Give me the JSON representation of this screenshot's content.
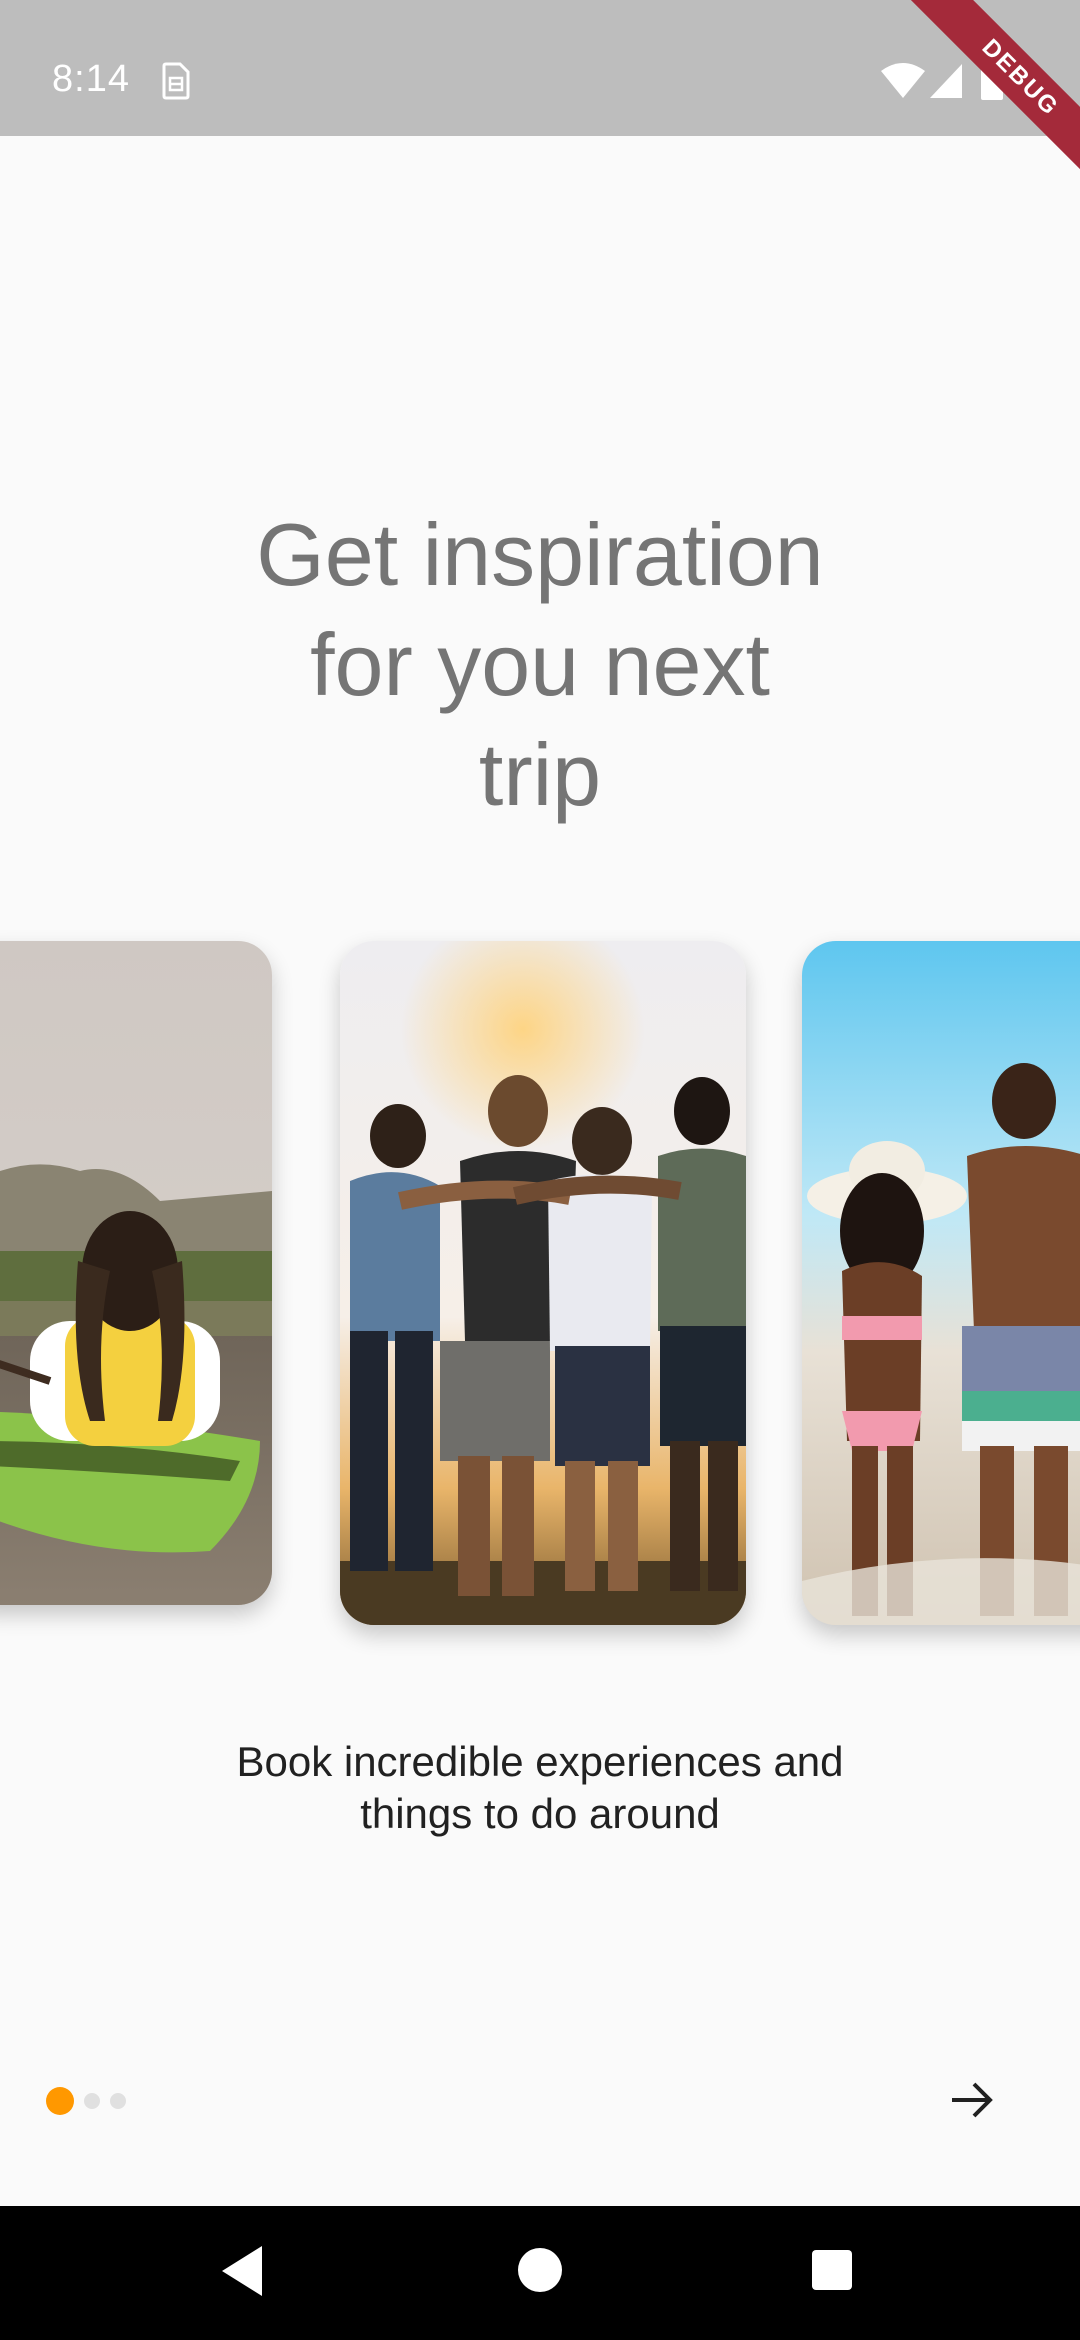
{
  "status_bar": {
    "time": "8:14",
    "icons": [
      "sim-card-icon",
      "wifi-icon",
      "cell-signal-icon",
      "battery-icon"
    ],
    "debug_label": "DEBUG"
  },
  "onboarding": {
    "title_lines": [
      "Get inspiration",
      "for you next",
      "trip"
    ],
    "subtitle_lines": [
      "Book incredible experiences and",
      "things to do around"
    ],
    "photos": [
      "woman-in-kayak-photo",
      "friends-at-sunset-photo",
      "couple-on-beach-photo"
    ],
    "page_indicator": {
      "count": 3,
      "active_index": 0
    },
    "next_icon": "arrow-right-icon"
  },
  "colors": {
    "accent": "#FF9800",
    "title": "#757575",
    "subtitle": "#212121",
    "status_bar": "#BDBDBD",
    "debug_ribbon": "#A42A3A",
    "background": "#FAFAFA"
  },
  "nav_bar": {
    "icons": [
      "back-icon",
      "home-icon",
      "recents-icon"
    ]
  }
}
